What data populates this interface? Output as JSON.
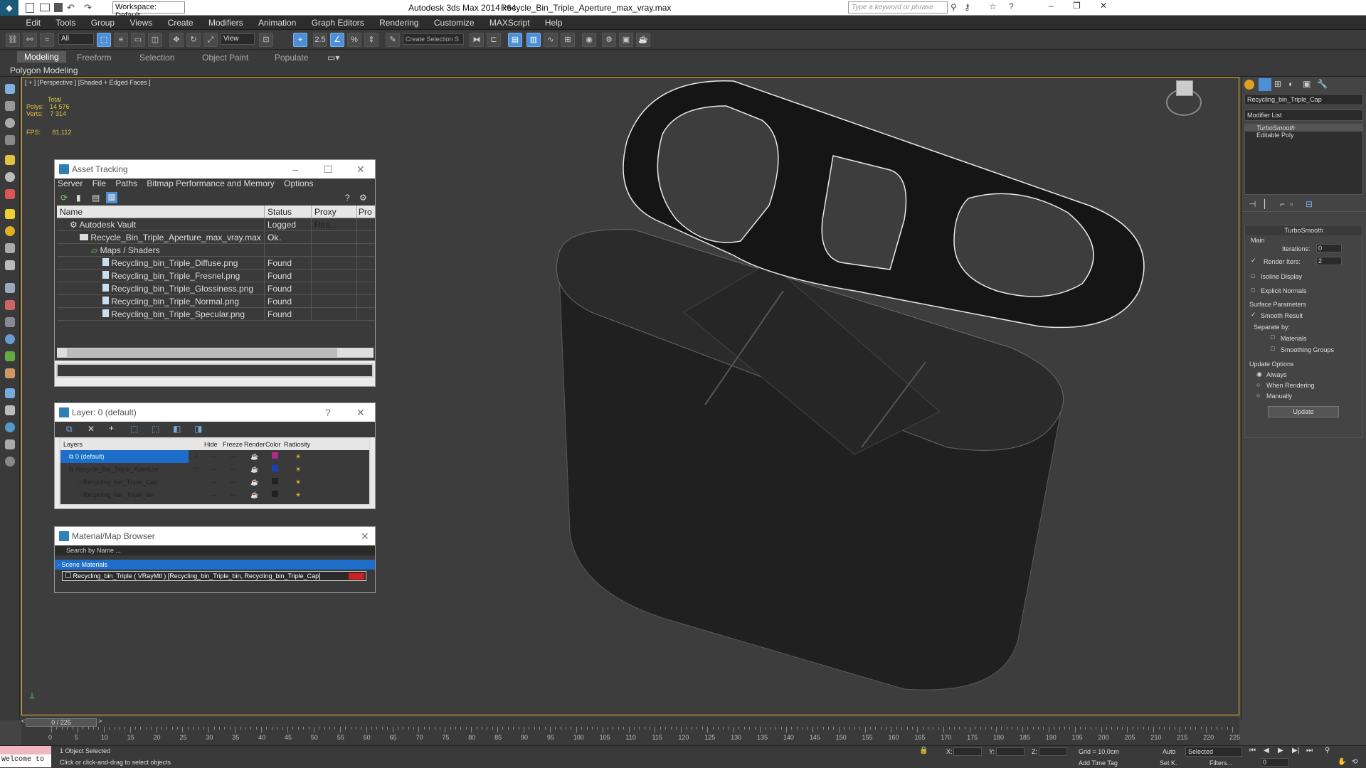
{
  "titlebar": {
    "workspace": "Workspace: Default",
    "app_title": "Autodesk 3ds Max  2014 x64",
    "file_title": "Recycle_Bin_Triple_Aperture_max_vray.max",
    "search_placeholder": "Type a keyword or phrase"
  },
  "menu": [
    "Edit",
    "Tools",
    "Group",
    "Views",
    "Create",
    "Modifiers",
    "Animation",
    "Graph Editors",
    "Rendering",
    "Customize",
    "MAXScript",
    "Help"
  ],
  "toolbar": {
    "filter": "All",
    "view": "View",
    "selset": "Create Selection S"
  },
  "ribbon": {
    "tabs": [
      "Modeling",
      "Freeform",
      "Selection",
      "Object Paint",
      "Populate"
    ],
    "sub": "Polygon Modeling"
  },
  "viewport": {
    "label": "[ + ] [Perspective ] [Shaded + Edged Faces ]",
    "stats_total": "Total",
    "polys_label": "Polys:",
    "polys": "14 576",
    "verts_label": "Verts:",
    "verts": "7 314",
    "fps_label": "FPS:",
    "fps": "81,112"
  },
  "asset_tracking": {
    "title": "Asset Tracking",
    "menu": [
      "Server",
      "File",
      "Paths",
      "Bitmap Performance and Memory",
      "Options"
    ],
    "headers": [
      "Name",
      "Status",
      "Proxy Res...",
      "Pro"
    ],
    "rows": [
      {
        "name": "Autodesk Vault",
        "status": "Logged O..."
      },
      {
        "name": "Recycle_Bin_Triple_Aperture_max_vray.max",
        "status": "Ok"
      },
      {
        "name": "Maps / Shaders",
        "status": ""
      },
      {
        "name": "Recycling_bin_Triple_Diffuse.png",
        "status": "Found"
      },
      {
        "name": "Recycling_bin_Triple_Fresnel.png",
        "status": "Found"
      },
      {
        "name": "Recycling_bin_Triple_Glossiness.png",
        "status": "Found"
      },
      {
        "name": "Recycling_bin_Triple_Normal.png",
        "status": "Found"
      },
      {
        "name": "Recycling_bin_Triple_Specular.png",
        "status": "Found"
      }
    ]
  },
  "layer": {
    "title": "Layer: 0 (default)",
    "headers": [
      "Layers",
      "Hide",
      "Freeze",
      "Render",
      "Color",
      "Radiosity"
    ],
    "rows": [
      {
        "name": "0 (default)",
        "color": "#b02a8a"
      },
      {
        "name": "Recycle_Bin_Triple_Aperture",
        "color": "#1a3fb8"
      },
      {
        "name": "Recycling_bin_Triple_Cap",
        "color": "#222222"
      },
      {
        "name": "Recycling_bin_Triple_bin",
        "color": "#222222"
      }
    ]
  },
  "material": {
    "title": "Material/Map Browser",
    "search": "Search by Name ...",
    "section": "- Scene Materials",
    "item": "Recycling_bin_Triple ( VRayMtl ) [Recycling_bin_Triple_bin, Recycling_bin_Triple_Cap]"
  },
  "cmdpanel": {
    "object": "Recycling_bin_Triple_Cap",
    "modlist": "Modifier List",
    "stack": [
      "TurboSmooth",
      "Editable Poly"
    ],
    "rollout": "TurboSmooth",
    "main": "Main",
    "iterations_label": "Iterations:",
    "iterations": "0",
    "render_iters_label": "Render Iters:",
    "render_iters": "2",
    "isoline": "Isoline Display",
    "explicit": "Explicit Normals",
    "surface": "Surface Parameters",
    "smooth": "Smooth Result",
    "separate": "Separate by:",
    "materials": "Materials",
    "smoothing": "Smoothing Groups",
    "update_opts": "Update Options",
    "always": "Always",
    "when_rendering": "When Rendering",
    "manually": "Manually",
    "update": "Update"
  },
  "timeline": {
    "frame": "0 / 225",
    "ticks": [
      "0",
      "5",
      "10",
      "15",
      "20",
      "25",
      "30",
      "35",
      "40",
      "45",
      "50",
      "55",
      "60",
      "65",
      "70",
      "75",
      "80",
      "85",
      "90",
      "95",
      "100",
      "105",
      "110",
      "115",
      "120",
      "125",
      "130",
      "135",
      "140",
      "145",
      "150",
      "155",
      "160",
      "165",
      "170",
      "175",
      "180",
      "185",
      "190",
      "195",
      "200",
      "205",
      "210",
      "215",
      "220",
      "225"
    ]
  },
  "status": {
    "welcome": "Welcome to",
    "selected": "1 Object Selected",
    "hint": "Click or click-and-drag to select objects",
    "x": "X:",
    "y": "Y:",
    "z": "Z:",
    "grid": "Grid = 10,0cm",
    "auto": "Auto",
    "selected_opt": "Selected",
    "setk": "Set K.",
    "filters": "Filters...",
    "add_time_tag": "Add Time Tag",
    "frame": "0"
  }
}
